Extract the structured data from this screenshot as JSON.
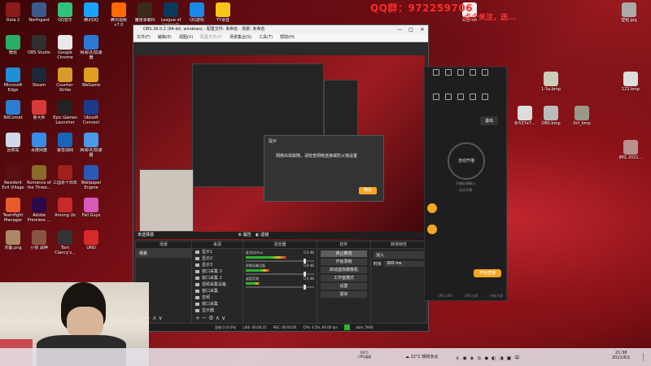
{
  "banner": {
    "qq": "QQ群：972259706",
    "follow": "点个关注，送..."
  },
  "desktop_icons_left": [
    {
      "label": "Dota 2",
      "color": "#8b1a1a"
    },
    {
      "label": "Northgard",
      "color": "#3a5a8a"
    },
    {
      "label": "QQ音乐",
      "color": "#31c27c"
    },
    {
      "label": "微信",
      "color": "#2aae67"
    },
    {
      "label": "OBS Studio",
      "color": "#303030"
    },
    {
      "label": "Google Chrome",
      "color": "#e8e8e8"
    },
    {
      "label": "Microsoft Edge",
      "color": "#1f8fd8"
    },
    {
      "label": "Steam",
      "color": "#1b2838"
    },
    {
      "label": "Counter-Strike Global Off...",
      "color": "#d89a2a"
    },
    {
      "label": "BitComet",
      "color": "#2b7fd1"
    },
    {
      "label": "鲁大师",
      "color": "#d83a3a"
    },
    {
      "label": "Epic Games Launcher",
      "color": "#222"
    },
    {
      "label": "回收站",
      "color": "#cfd8e8"
    },
    {
      "label": "百度网盘",
      "color": "#3a8ae8"
    },
    {
      "label": "暴雪战网",
      "color": "#1a64b8"
    },
    {
      "label": "Resident Evil Village",
      "color": "#5a1010"
    },
    {
      "label": "Romance of the Three...",
      "color": "#8a6a2a"
    },
    {
      "label": "三国杀十周年",
      "color": "#a02020"
    },
    {
      "label": "Teamfight Manager",
      "color": "#e85a2a"
    },
    {
      "label": "Adobe Premiere ...",
      "color": "#2a0a4a"
    },
    {
      "label": "Among Us",
      "color": "#c82a2a"
    },
    {
      "label": "刘备.png",
      "color": "#aa8866"
    },
    {
      "label": "小孩 战神",
      "color": "#885544"
    },
    {
      "label": "Tom Clancy's...",
      "color": "#333"
    }
  ],
  "desktop_icons_left2": [
    {
      "label": "腾讯QQ",
      "color": "#1aa3ff"
    },
    {
      "label": "网易UU加速器",
      "color": "#2a7ad8"
    },
    {
      "label": "WeGame",
      "color": "#e0a020"
    },
    {
      "label": "Ubisoft Connect",
      "color": "#1a3a8a"
    },
    {
      "label": "网易UU加速器",
      "color": "#4a9ae8"
    },
    {
      "label": "Wallpaper Engine",
      "color": "#2a5ab8"
    },
    {
      "label": "Fall Guys",
      "color": "#d85ab8"
    },
    {
      "label": "UNO",
      "color": "#d82a2a"
    }
  ],
  "desktop_icons_mid": [
    {
      "label": "腾讯视频 v7.0",
      "color": "#ff6a00"
    },
    {
      "label": "魔兽争霸III",
      "color": "#3a2a1a"
    },
    {
      "label": "League of Legends",
      "color": "#0a3a5a"
    },
    {
      "label": "QQ游戏",
      "color": "#1a8ae8"
    },
    {
      "label": "YY语音",
      "color": "#f5c518"
    }
  ],
  "desktop_icons_right": [
    {
      "label": "壁纸.jpg",
      "color": "#aaa"
    },
    {
      "label": "公告.txt",
      "color": "#eee"
    },
    {
      "label": "123.bmp",
      "color": "#ddd"
    },
    {
      "label": "IMG 2021...",
      "color": "#b89090"
    },
    {
      "label": "1-5a.bmp",
      "color": "#ccb"
    },
    {
      "label": "OBS.bmp",
      "color": "#bbb"
    },
    {
      "label": "0cf_bmp",
      "color": "#998"
    },
    {
      "label": "8r537e7...",
      "color": "#ddd"
    }
  ],
  "obs": {
    "title": "OBS 26.0.2 (64-bit, windows) - 配置文件: 未命名 - 场景: 未命名",
    "menu": [
      "文件(F)",
      "编辑(E)",
      "视图(V)",
      "配置文件(P)",
      "场景集合(S)",
      "工具(T)",
      "帮助(H)"
    ],
    "window_controls": [
      "—",
      "□",
      "✕"
    ],
    "dialog": {
      "title": "提示",
      "message": "网络出现故障，请检查网络连接或防火墙设置",
      "button": "确定"
    },
    "scene_bar": "未选择源",
    "scene_bar_props": "属性",
    "scene_bar_filter": "滤镜",
    "docks": {
      "scenes": {
        "title": "场景",
        "items": [
          "场景"
        ]
      },
      "sources": {
        "title": "来源",
        "items": [
          "显示1",
          "显示2",
          "显示3",
          "窗口采集 3",
          "窗口采集 2",
          "视频采集设备",
          "窗口采集",
          "音频",
          "窗口采集",
          "显示器"
        ]
      },
      "mixer": {
        "title": "混音器",
        "channels": [
          {
            "name": "麦克风/Aux",
            "db": "0.0 dB",
            "level": 0.6
          },
          {
            "name": "视频采集设备",
            "db": "0.0 dB",
            "level": 0.35
          },
          {
            "name": "桌面音频",
            "db": "0.0 dB",
            "level": 0.2
          }
        ]
      },
      "controls": {
        "title": "控件",
        "buttons": [
          "停止推流",
          "开始录制",
          "启动虚拟摄像机",
          "工作室模式",
          "设置",
          "退出"
        ],
        "active_index": 0
      },
      "transitions": {
        "title": "转场特性",
        "mode": "淡入",
        "duration_label": "时长",
        "duration": "300 ms"
      }
    },
    "status": {
      "dropped": "丢帧 0 (0.0%)",
      "live": "LIVE: 00:00:25",
      "rec": "REC: 00:00:00",
      "cpu": "CPU: 4.5%, 60.00 fps",
      "kbps": "kb/s: 5940"
    }
  },
  "livestream": {
    "start_circle": "自动开播",
    "desc1": "开播前请确认",
    "desc2": "自动开播",
    "exit": "退出",
    "start_button": "开始直播",
    "footer": [
      "CPU 16%",
      "CPU占用",
      "内存占用"
    ]
  },
  "taskbar": {
    "weather": "22°C 晴转多云",
    "cpu_temp": "64°C",
    "cpu_label": "CPU温度",
    "time": "21:38",
    "date": "2021/6/1"
  },
  "colors": {
    "accent": "#f5a623",
    "live_green": "#2db32d",
    "qq_red": "#ff2a2a"
  }
}
